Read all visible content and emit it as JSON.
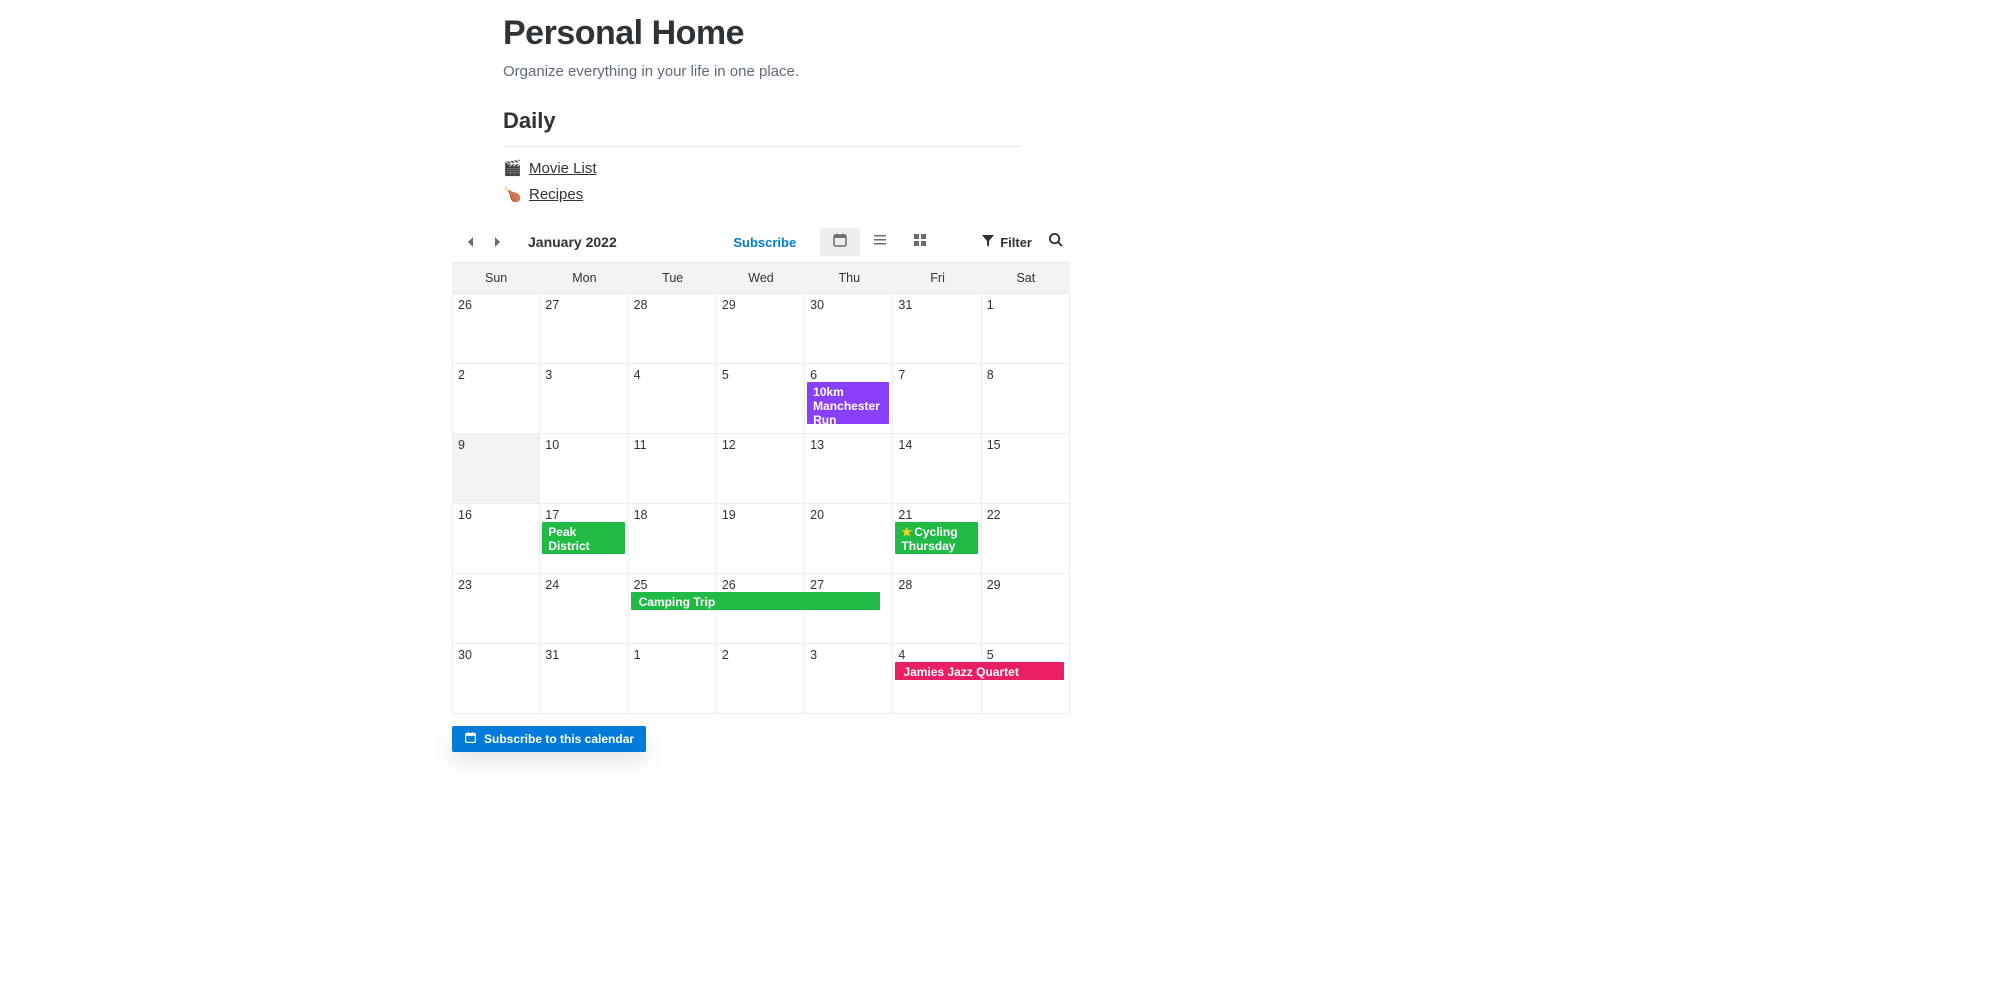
{
  "header": {
    "title": "Personal Home",
    "subtitle": "Organize everything in your life in one place."
  },
  "daily": {
    "heading": "Daily",
    "links": [
      {
        "emoji": "🎬",
        "label": "Movie List"
      },
      {
        "emoji": "🍗",
        "label": "Recipes"
      }
    ]
  },
  "calendar": {
    "month_label": "January 2022",
    "subscribe": "Subscribe",
    "filter": "Filter",
    "subscribe_button": "Subscribe to this calendar",
    "dow": [
      "Sun",
      "Mon",
      "Tue",
      "Wed",
      "Thu",
      "Fri",
      "Sat"
    ],
    "weeks": [
      [
        "26",
        "27",
        "28",
        "29",
        "30",
        "31",
        "1"
      ],
      [
        "2",
        "3",
        "4",
        "5",
        "6",
        "7",
        "8"
      ],
      [
        "9",
        "10",
        "11",
        "12",
        "13",
        "14",
        "15"
      ],
      [
        "16",
        "17",
        "18",
        "19",
        "20",
        "21",
        "22"
      ],
      [
        "23",
        "24",
        "25",
        "26",
        "27",
        "28",
        "29"
      ],
      [
        "30",
        "31",
        "1",
        "2",
        "3",
        "4",
        "5"
      ]
    ],
    "today": "9",
    "events": {
      "w1_thu": "10km Manchester Run",
      "w3_mon": "Peak District Walk",
      "w3_fri": "Cycling Thursday",
      "w4_tue": "Camping Trip",
      "w5_fri": "Jamies Jazz Quartet"
    }
  }
}
